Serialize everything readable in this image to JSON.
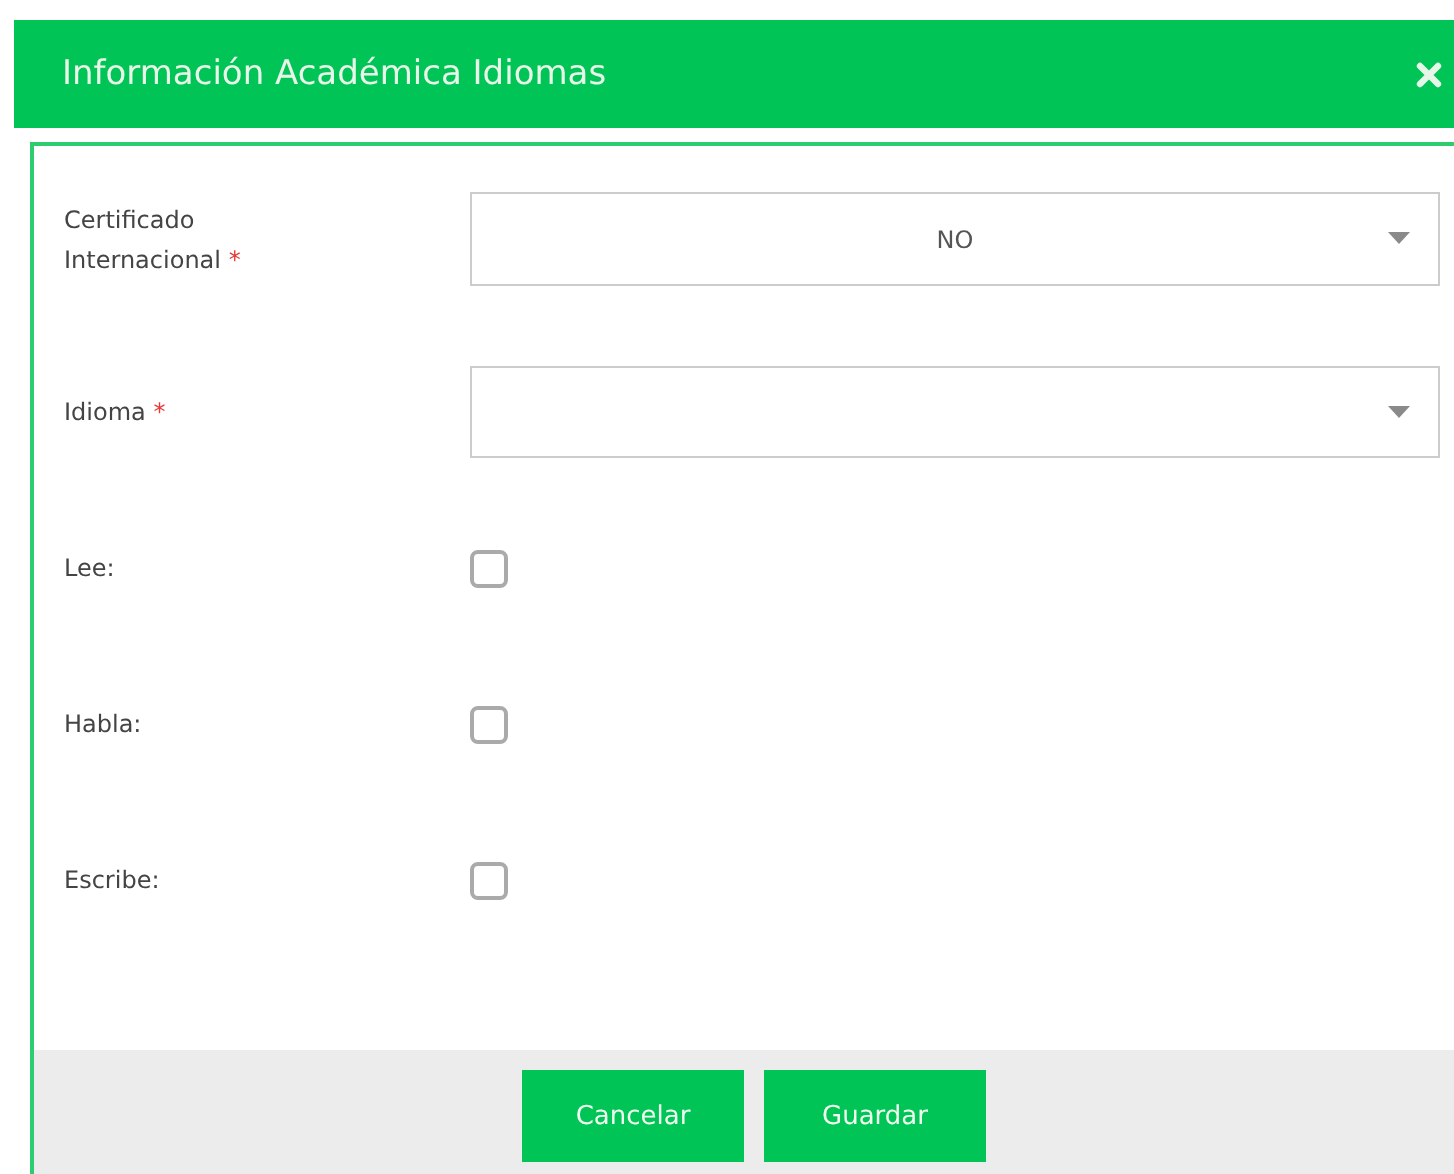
{
  "dialog": {
    "title": "Información Académica Idiomas"
  },
  "fields": [
    {
      "kind": "select",
      "label": "Certificado Internacional",
      "required": true,
      "value": "NO"
    },
    {
      "kind": "select",
      "label": "Idioma",
      "required": true
    },
    {
      "kind": "checkbox",
      "label": "Lee:",
      "checked": false
    },
    {
      "kind": "checkbox",
      "label": "Habla:",
      "checked": false
    },
    {
      "kind": "checkbox",
      "label": "Escribe:",
      "checked": false
    }
  ],
  "required_mark": "*",
  "buttons": [
    {
      "label": "Cancelar"
    },
    {
      "label": "Guardar"
    }
  ]
}
